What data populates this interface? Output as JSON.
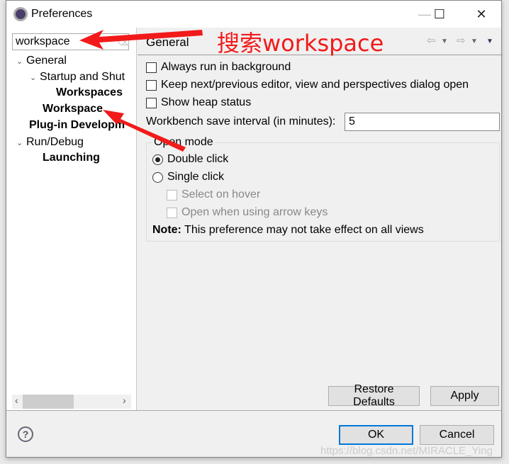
{
  "window": {
    "title": "Preferences",
    "minimize": "—",
    "maximize": "☐",
    "close": "✕"
  },
  "search": {
    "value": "workspace"
  },
  "tree": [
    {
      "label": "General",
      "level": 0,
      "expanded": true,
      "bold": false
    },
    {
      "label": "Startup and Shut",
      "level": 1,
      "expanded": true,
      "bold": false
    },
    {
      "label": "Workspaces",
      "level": 2,
      "bold": true
    },
    {
      "label": "Workspace",
      "level": 1,
      "bold": true
    },
    {
      "label": "Plug-in Developm",
      "level": 0,
      "bold": true
    },
    {
      "label": "Run/Debug",
      "level": 0,
      "expanded": true,
      "bold": false
    },
    {
      "label": "Launching",
      "level": 1,
      "bold": true
    }
  ],
  "page": {
    "title": "General",
    "checkboxes": [
      {
        "label": "Always run in background",
        "checked": false
      },
      {
        "label": "Keep next/previous editor, view and perspectives dialog open",
        "checked": false
      },
      {
        "label": "Show heap status",
        "checked": false
      }
    ],
    "save_interval_label": "Workbench save interval (in minutes):",
    "save_interval_value": "5",
    "open_mode": {
      "label": "Open mode",
      "double_click": "Double click",
      "single_click": "Single click",
      "selected": "Double click",
      "select_on_hover": "Select on hover",
      "open_arrow_keys": "Open when using arrow keys",
      "note_bold": "Note:",
      "note": " This preference may not take effect on all views"
    },
    "restore_defaults": "Restore Defaults",
    "apply": "Apply"
  },
  "footer": {
    "ok": "OK",
    "cancel": "Cancel",
    "help": "?"
  },
  "annotation": {
    "text": "搜索workspace",
    "color": "#f21a1a"
  },
  "watermark": "https://blog.csdn.net/MIRACLE_Ying"
}
